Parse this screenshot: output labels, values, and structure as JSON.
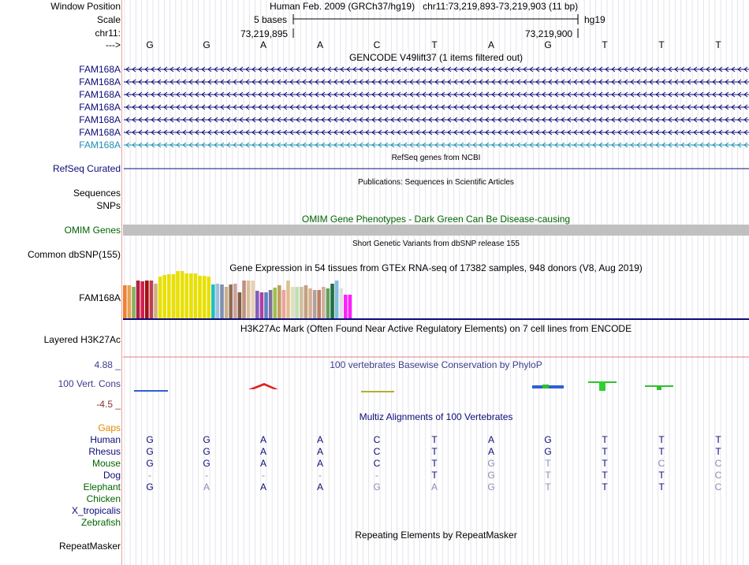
{
  "header": {
    "window_position_label": "Window Position",
    "scale_label": "Scale",
    "chrom_label": "chr11:",
    "strand_label": "--->",
    "assembly_text": "Human Feb. 2009 (GRCh37/hg19)",
    "position_text": "chr11:73,219,893-73,219,903 (11 bp)",
    "scale_text": "5 bases",
    "db_text": "hg19",
    "coord_left": "73,219,895",
    "coord_right": "73,219,900"
  },
  "bases": [
    "G",
    "G",
    "A",
    "A",
    "C",
    "T",
    "A",
    "G",
    "T",
    "T",
    "T"
  ],
  "gencode": {
    "title": "GENCODE V49lift37 (1 items filtered out)",
    "items": [
      {
        "label": "FAM168A",
        "color": "#0c0c78"
      },
      {
        "label": "FAM168A",
        "color": "#0c0c78"
      },
      {
        "label": "FAM168A",
        "color": "#0c0c78"
      },
      {
        "label": "FAM168A",
        "color": "#0c0c78"
      },
      {
        "label": "FAM168A",
        "color": "#0c0c78"
      },
      {
        "label": "FAM168A",
        "color": "#0c0c78"
      },
      {
        "label": "FAM168A",
        "color": "#1e90b4"
      }
    ]
  },
  "refseq": {
    "title": "RefSeq genes from NCBI",
    "label": "RefSeq Curated",
    "color": "#0c0c78"
  },
  "publications": {
    "title": "Publications: Sequences in Scientific Articles",
    "label1": "Sequences",
    "label2": "SNPs"
  },
  "omim": {
    "title": "OMIM Gene Phenotypes - Dark Green Can Be Disease-causing",
    "label": "OMIM Genes",
    "color": "#006400"
  },
  "dbsnp": {
    "title": "Short Genetic Variants from dbSNP release 155",
    "label": "Common dbSNP(155)"
  },
  "gtex": {
    "title": "Gene Expression in 54 tissues from GTEx RNA-seq of 17382 samples, 948 donors (V8, Aug 2019)",
    "label": "FAM168A",
    "bar_heights": [
      0.42,
      0.42,
      0.4,
      0.48,
      0.47,
      0.48,
      0.48,
      0.44,
      0.53,
      0.55,
      0.56,
      0.56,
      0.6,
      0.6,
      0.57,
      0.57,
      0.57,
      0.54,
      0.54,
      0.53,
      0.43,
      0.44,
      0.43,
      0.4,
      0.43,
      0.44,
      0.33,
      0.48,
      0.48,
      0.48,
      0.35,
      0.33,
      0.33,
      0.36,
      0.39,
      0.42,
      0.36,
      0.48,
      0.4,
      0.4,
      0.4,
      0.42,
      0.38,
      0.36,
      0.36,
      0.4,
      0.38,
      0.44,
      0.48,
      0.38,
      0.3,
      0.3
    ],
    "bar_colors": [
      "#f08030",
      "#e8a050",
      "#88b060",
      "#b02040",
      "#d02050",
      "#a01010",
      "#c04050",
      "#d0b080",
      "#e8e000",
      "#e8e000",
      "#e8e000",
      "#e8e000",
      "#e8e000",
      "#e8e000",
      "#e8e000",
      "#e8e000",
      "#e8e000",
      "#e8e000",
      "#e8e000",
      "#e8e000",
      "#20c0c0",
      "#a0c0e0",
      "#8090b0",
      "#c8b090",
      "#8f6f50",
      "#d0a0a0",
      "#806040",
      "#c09080",
      "#d8c0a0",
      "#e8d0b0",
      "#8060c0",
      "#b040a0",
      "#6080c0",
      "#8070a0",
      "#a0c050",
      "#c0a060",
      "#f0a0a0",
      "#e0c090",
      "#e0e0c0",
      "#c0e0b0",
      "#d0c0a0",
      "#c0a080",
      "#d8b090",
      "#b0a0a0",
      "#c08060",
      "#d0b0a0",
      "#60a060",
      "#207040",
      "#80c0e0",
      "#e0e0e0",
      "#ff20ff",
      "#ff20ff"
    ]
  },
  "h3k27ac": {
    "title": "H3K27Ac Mark (Often Found Near Active Regulatory Elements) on 7 cell lines from ENCODE",
    "label": "Layered H3K27Ac"
  },
  "phylop": {
    "title": "100 vertebrates Basewise Conservation by PhyloP",
    "label": "100 Vert. Cons",
    "max_label": "4.88 _",
    "min_label": "-4.5 _",
    "color": "#3c3c8c",
    "min_color": "#8b2f2f"
  },
  "multiz": {
    "title": "Multiz Alignments of 100 Vertebrates",
    "gaps_label": "Gaps",
    "gaps_color": "#e08a00",
    "species": [
      {
        "name": "Human",
        "color": "#0c0c78",
        "bases": [
          "G",
          "G",
          "A",
          "A",
          "C",
          "T",
          "A",
          "G",
          "T",
          "T",
          "T"
        ],
        "dim": [
          0,
          0,
          0,
          0,
          0,
          0,
          0,
          0,
          0,
          0,
          0
        ]
      },
      {
        "name": "Rhesus",
        "color": "#0c0c78",
        "bases": [
          "G",
          "G",
          "A",
          "A",
          "C",
          "T",
          "A",
          "G",
          "T",
          "T",
          "T"
        ],
        "dim": [
          0,
          0,
          0,
          0,
          0,
          0,
          0,
          0,
          0,
          0,
          0
        ]
      },
      {
        "name": "Mouse",
        "color": "#006400",
        "bases": [
          "G",
          "G",
          "A",
          "A",
          "C",
          "T",
          "G",
          "T",
          "T",
          "C",
          "C"
        ],
        "dim": [
          0,
          0,
          0,
          0,
          0,
          0,
          1,
          1,
          0,
          1,
          1
        ]
      },
      {
        "name": "Dog",
        "color": "#0c0c78",
        "bases": [
          "-",
          "-",
          "-",
          "-",
          "-",
          "T",
          "G",
          "T",
          "T",
          "T",
          "C"
        ],
        "dim": [
          1,
          1,
          1,
          1,
          1,
          0,
          1,
          1,
          0,
          0,
          1
        ]
      },
      {
        "name": "Elephant",
        "color": "#006400",
        "bases": [
          "G",
          "A",
          "A",
          "A",
          "G",
          "A",
          "G",
          "T",
          "T",
          "T",
          "C"
        ],
        "dim": [
          0,
          1,
          0,
          0,
          1,
          1,
          1,
          1,
          0,
          0,
          1
        ]
      },
      {
        "name": "Chicken",
        "color": "#006400",
        "bases": [],
        "dim": []
      },
      {
        "name": "X_tropicalis",
        "color": "#0c0c78",
        "bases": [],
        "dim": []
      },
      {
        "name": "Zebrafish",
        "color": "#006400",
        "bases": [],
        "dim": []
      }
    ]
  },
  "repeatmasker": {
    "title": "Repeating Elements by RepeatMasker",
    "label": "RepeatMasker"
  }
}
